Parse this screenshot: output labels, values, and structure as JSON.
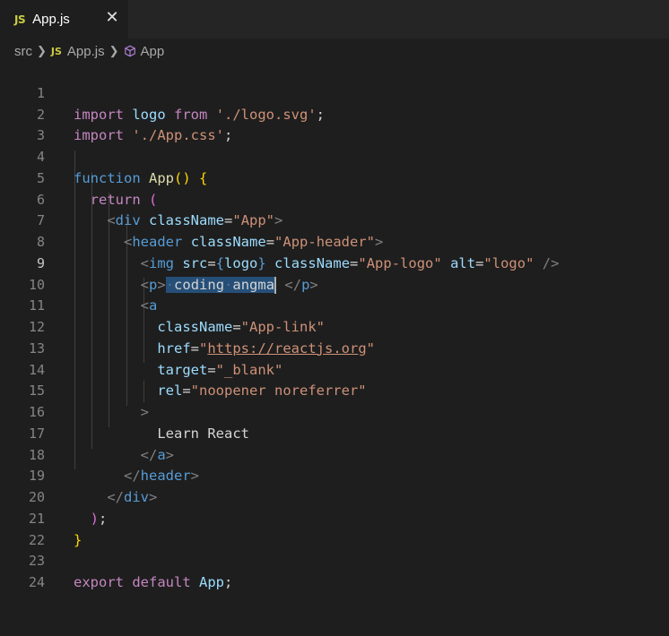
{
  "tab": {
    "badge": "JS",
    "filename": "App.js",
    "close_symbol": "✕"
  },
  "breadcrumb": {
    "folder": "src",
    "file_badge": "JS",
    "file": "App.js",
    "symbol": "App"
  },
  "editor": {
    "active_line": 9,
    "lines": [
      {
        "n": "1"
      },
      {
        "n": "2"
      },
      {
        "n": "3"
      },
      {
        "n": "4"
      },
      {
        "n": "5"
      },
      {
        "n": "6"
      },
      {
        "n": "7"
      },
      {
        "n": "8"
      },
      {
        "n": "9"
      },
      {
        "n": "10"
      },
      {
        "n": "11"
      },
      {
        "n": "12"
      },
      {
        "n": "13"
      },
      {
        "n": "14"
      },
      {
        "n": "15"
      },
      {
        "n": "16"
      },
      {
        "n": "17"
      },
      {
        "n": "18"
      },
      {
        "n": "19"
      },
      {
        "n": "20"
      },
      {
        "n": "21"
      },
      {
        "n": "22"
      },
      {
        "n": "23"
      },
      {
        "n": "24"
      }
    ],
    "tokens": {
      "import": "import",
      "logo": "logo",
      "from": "from",
      "logo_path": "'./logo.svg'",
      "css_path": "'./App.css'",
      "semicolon": ";",
      "function": "function",
      "app": "App",
      "return": "return",
      "div": "div",
      "header": "header",
      "img": "img",
      "p": "p",
      "a": "a",
      "className": "className",
      "src": "src",
      "alt": "alt",
      "href": "href",
      "target": "target",
      "rel": "rel",
      "str_app": "\"App\"",
      "str_app_header": "\"App-header\"",
      "str_app_logo": "\"App-logo\"",
      "str_logo": "\"logo\"",
      "str_app_link": "\"App-link\"",
      "url": "https://reactjs.org",
      "str_blank": "\"_blank\"",
      "str_rel": "\"noopener noreferrer\"",
      "selected_text": "coding",
      "selected_text_2": "angma",
      "learn_react": "Learn React",
      "export": "export",
      "default": "default"
    }
  },
  "colors": {
    "background": "#1e1e1e",
    "tabbar": "#252526",
    "keyword": "#c586c0",
    "string": "#ce9178",
    "tag": "#569cd6",
    "attribute": "#9cdcfe",
    "function": "#dcdcaa",
    "selection": "#264f78"
  }
}
